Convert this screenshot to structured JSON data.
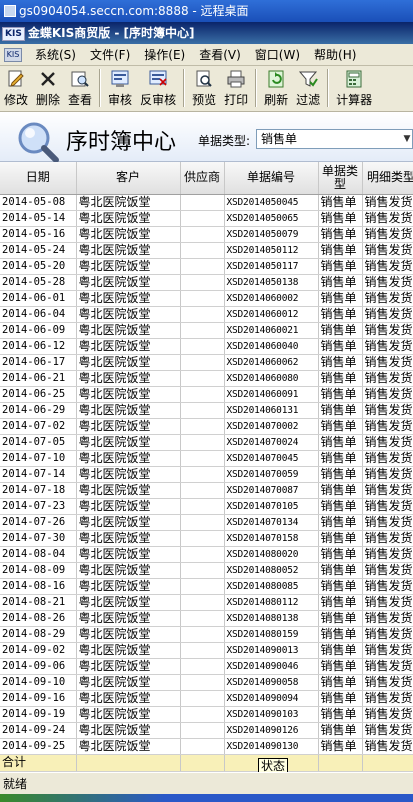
{
  "remote": {
    "title": "gs0904054.seccn.com:8888 - 远程桌面"
  },
  "app": {
    "logo": "KIS",
    "title": "金蝶KIS商贸版 - [序时簿中心]"
  },
  "menu": {
    "logo": "KIS",
    "items": [
      "系统(S)",
      "文件(F)",
      "操作(E)",
      "查看(V)",
      "窗口(W)",
      "帮助(H)"
    ]
  },
  "toolbar": {
    "buttons": [
      {
        "label": "修改",
        "icon": "edit-icon"
      },
      {
        "label": "删除",
        "icon": "delete-icon"
      },
      {
        "label": "查看",
        "icon": "view-icon"
      },
      {
        "label": "审核",
        "icon": "approve-icon"
      },
      {
        "label": "反审核",
        "icon": "unapprove-icon"
      },
      {
        "label": "预览",
        "icon": "preview-icon"
      },
      {
        "label": "打印",
        "icon": "print-icon"
      },
      {
        "label": "刷新",
        "icon": "refresh-icon"
      },
      {
        "label": "过滤",
        "icon": "filter-icon"
      },
      {
        "label": "计算器",
        "icon": "calculator-icon"
      }
    ]
  },
  "header": {
    "title": "序时簿中心",
    "type_label": "单据类型:",
    "type_value": "销售单"
  },
  "grid": {
    "columns": [
      "日期",
      "客户",
      "供应商",
      "单据编号",
      "单据类型",
      "明细类型"
    ],
    "rows": [
      [
        "2014-05-08",
        "粤北医院饭堂",
        "",
        "XSD2014050045",
        "销售单",
        "销售发货"
      ],
      [
        "2014-05-14",
        "粤北医院饭堂",
        "",
        "XSD2014050065",
        "销售单",
        "销售发货"
      ],
      [
        "2014-05-16",
        "粤北医院饭堂",
        "",
        "XSD2014050079",
        "销售单",
        "销售发货"
      ],
      [
        "2014-05-24",
        "粤北医院饭堂",
        "",
        "XSD2014050112",
        "销售单",
        "销售发货"
      ],
      [
        "2014-05-20",
        "粤北医院饭堂",
        "",
        "XSD2014050117",
        "销售单",
        "销售发货"
      ],
      [
        "2014-05-28",
        "粤北医院饭堂",
        "",
        "XSD2014050138",
        "销售单",
        "销售发货"
      ],
      [
        "2014-06-01",
        "粤北医院饭堂",
        "",
        "XSD2014060002",
        "销售单",
        "销售发货"
      ],
      [
        "2014-06-04",
        "粤北医院饭堂",
        "",
        "XSD2014060012",
        "销售单",
        "销售发货"
      ],
      [
        "2014-06-09",
        "粤北医院饭堂",
        "",
        "XSD2014060021",
        "销售单",
        "销售发货"
      ],
      [
        "2014-06-12",
        "粤北医院饭堂",
        "",
        "XSD2014060040",
        "销售单",
        "销售发货"
      ],
      [
        "2014-06-17",
        "粤北医院饭堂",
        "",
        "XSD2014060062",
        "销售单",
        "销售发货"
      ],
      [
        "2014-06-21",
        "粤北医院饭堂",
        "",
        "XSD2014060080",
        "销售单",
        "销售发货"
      ],
      [
        "2014-06-25",
        "粤北医院饭堂",
        "",
        "XSD2014060091",
        "销售单",
        "销售发货"
      ],
      [
        "2014-06-29",
        "粤北医院饭堂",
        "",
        "XSD2014060131",
        "销售单",
        "销售发货"
      ],
      [
        "2014-07-02",
        "粤北医院饭堂",
        "",
        "XSD2014070002",
        "销售单",
        "销售发货"
      ],
      [
        "2014-07-05",
        "粤北医院饭堂",
        "",
        "XSD2014070024",
        "销售单",
        "销售发货"
      ],
      [
        "2014-07-10",
        "粤北医院饭堂",
        "",
        "XSD2014070045",
        "销售单",
        "销售发货"
      ],
      [
        "2014-07-14",
        "粤北医院饭堂",
        "",
        "XSD2014070059",
        "销售单",
        "销售发货"
      ],
      [
        "2014-07-18",
        "粤北医院饭堂",
        "",
        "XSD2014070087",
        "销售单",
        "销售发货"
      ],
      [
        "2014-07-23",
        "粤北医院饭堂",
        "",
        "XSD2014070105",
        "销售单",
        "销售发货"
      ],
      [
        "2014-07-26",
        "粤北医院饭堂",
        "",
        "XSD2014070134",
        "销售单",
        "销售发货"
      ],
      [
        "2014-07-30",
        "粤北医院饭堂",
        "",
        "XSD2014070158",
        "销售单",
        "销售发货"
      ],
      [
        "2014-08-04",
        "粤北医院饭堂",
        "",
        "XSD2014080020",
        "销售单",
        "销售发货"
      ],
      [
        "2014-08-09",
        "粤北医院饭堂",
        "",
        "XSD2014080052",
        "销售单",
        "销售发货"
      ],
      [
        "2014-08-16",
        "粤北医院饭堂",
        "",
        "XSD2014080085",
        "销售单",
        "销售发货"
      ],
      [
        "2014-08-21",
        "粤北医院饭堂",
        "",
        "XSD2014080112",
        "销售单",
        "销售发货"
      ],
      [
        "2014-08-26",
        "粤北医院饭堂",
        "",
        "XSD2014080138",
        "销售单",
        "销售发货"
      ],
      [
        "2014-08-29",
        "粤北医院饭堂",
        "",
        "XSD2014080159",
        "销售单",
        "销售发货"
      ],
      [
        "2014-09-02",
        "粤北医院饭堂",
        "",
        "XSD2014090013",
        "销售单",
        "销售发货"
      ],
      [
        "2014-09-06",
        "粤北医院饭堂",
        "",
        "XSD2014090046",
        "销售单",
        "销售发货"
      ],
      [
        "2014-09-10",
        "粤北医院饭堂",
        "",
        "XSD2014090058",
        "销售单",
        "销售发货"
      ],
      [
        "2014-09-16",
        "粤北医院饭堂",
        "",
        "XSD2014090094",
        "销售单",
        "销售发货"
      ],
      [
        "2014-09-19",
        "粤北医院饭堂",
        "",
        "XSD2014090103",
        "销售单",
        "销售发货"
      ],
      [
        "2014-09-24",
        "粤北医院饭堂",
        "",
        "XSD2014090126",
        "销售单",
        "销售发货"
      ],
      [
        "2014-09-25",
        "粤北医院饭堂",
        "",
        "XSD2014090130",
        "销售单",
        "销售发货"
      ]
    ],
    "total_label": "合计"
  },
  "tooltip": "状态",
  "status": {
    "text": "就绪"
  }
}
